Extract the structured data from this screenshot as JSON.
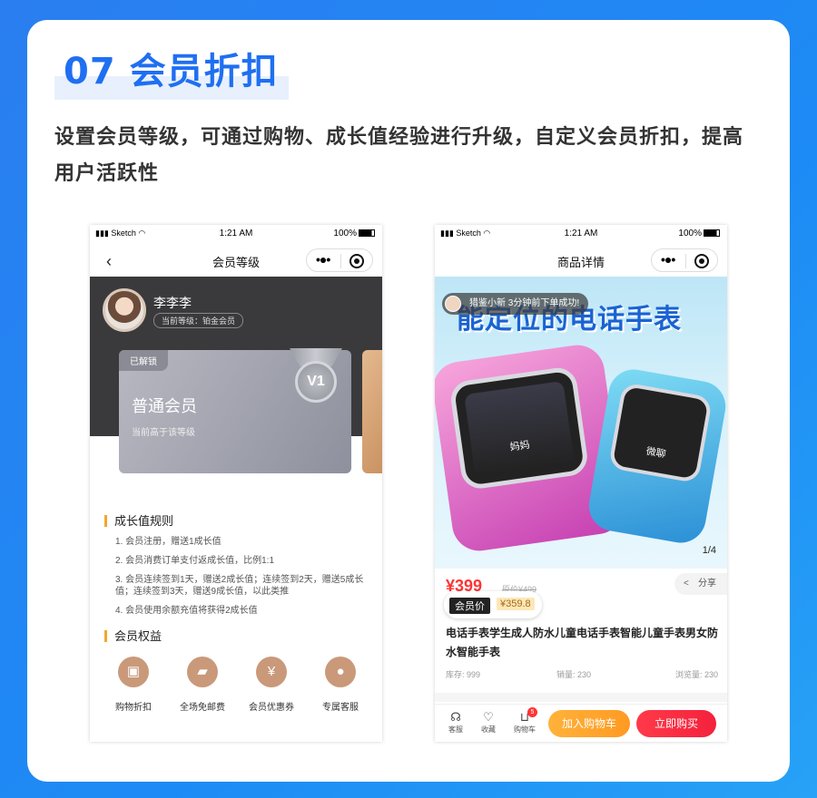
{
  "section": {
    "number": "07",
    "title": "会员折扣",
    "description": "设置会员等级，可通过购物、成长值经验进行升级，自定义会员折扣，提高用户活跃性"
  },
  "status_bar": {
    "carrier": "Sketch",
    "time": "1:21 AM",
    "battery": "100%"
  },
  "phone1": {
    "nav_title": "会员等级",
    "user": {
      "name": "李李李",
      "level": "当前等级：铂金会员"
    },
    "card": {
      "tag": "已解锁",
      "name": "普通会员",
      "sub": "当前高于该等级",
      "medal": "V1"
    },
    "growth": {
      "title": "成长值规则",
      "rules": [
        "1. 会员注册，赠送1成长值",
        "2. 会员消费订单支付返成长值，比例1:1",
        "3. 会员连续签到1天，赠送2成长值；连续签到2天，赠送5成长值；连续签到3天，赠送9成长值，以此类推",
        "4. 会员使用余额充值将获得2成长值"
      ]
    },
    "benefits": {
      "title": "会员权益",
      "items": [
        {
          "label": "购物折扣",
          "icon": "shopping-bag-icon"
        },
        {
          "label": "全场免邮费",
          "icon": "delivery-truck-icon"
        },
        {
          "label": "会员优惠券",
          "icon": "coupon-icon"
        },
        {
          "label": "专属客服",
          "icon": "user-service-icon"
        }
      ]
    }
  },
  "phone2": {
    "nav_title": "商品详情",
    "banner": {
      "headline": "能定位的电话手表",
      "toast": "猎鉴小新 3分钟前下单成功!",
      "watch_left_label": "妈妈",
      "watch_right_label": "微聊",
      "counter": "1/4"
    },
    "price": "¥399",
    "original_price": "原价¥499",
    "share": "分享",
    "member_price_label": "会员价",
    "member_price": "¥359.8",
    "product_name": "电话手表学生成人防水儿童电话手表智能儿童手表男女防水智能手表",
    "stats": {
      "stock": "库存: 999",
      "sales": "销量: 230",
      "views": "浏览量: 230"
    },
    "bottom": {
      "service": "客服",
      "favorite": "收藏",
      "cart": "购物车",
      "cart_count": "5",
      "add_to_cart": "加入购物车",
      "buy_now": "立即购买"
    }
  },
  "colors": {
    "accent": "#1f6ff2",
    "gold": "#f0a830",
    "buy": "#f4213c",
    "cart": "#ff9a22"
  }
}
